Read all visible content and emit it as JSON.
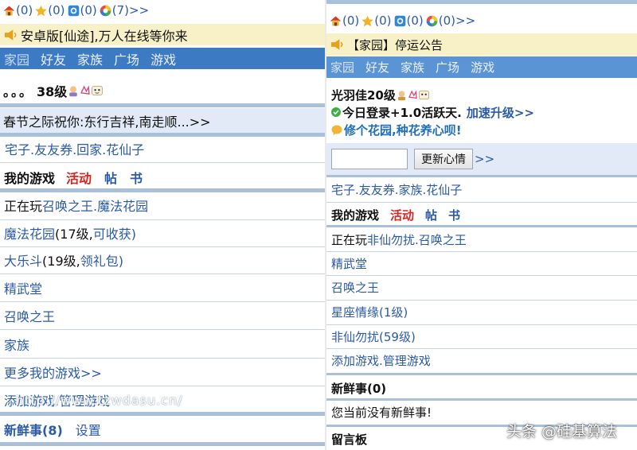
{
  "left": {
    "status_counts": [
      "(0)",
      "(0)",
      "(0)",
      "(7)>>"
    ],
    "status_icons": [
      "home-icon",
      "star-icon",
      "message-icon",
      "ring-icon"
    ],
    "notice": "安卓版[仙途],万人在线等你来",
    "nav": [
      "家园",
      "好友",
      "家族",
      "广场",
      "游戏"
    ],
    "user_dots": "。。。",
    "user_level": "38级",
    "greeting": "春节之际祝你:东行吉祥,南走顺...>>",
    "links_line": "宅子.友友券.回家.花仙子",
    "games_header": {
      "title": "我的游戏",
      "activity": "活动",
      "post": "帖",
      "book": "书"
    },
    "playing_prefix": "正在玩",
    "playing_games": "召唤之王.魔法花园",
    "games": [
      {
        "name": "魔法花园",
        "note": "(17级,",
        "action": "可收获)"
      },
      {
        "name": "大乐斗",
        "note": "(19级,",
        "action": "领礼包)"
      }
    ],
    "simple_items": [
      "精武堂",
      "召唤之王",
      "家族",
      "更多我的游戏>>",
      "添加游戏.管理游戏"
    ],
    "news": "新鲜事(8)",
    "settings": "设置"
  },
  "right": {
    "status_counts": [
      "(0)",
      "(0)",
      "(0)",
      "(0)>>"
    ],
    "status_icons": [
      "home-icon",
      "star-icon",
      "message-icon",
      "ring-icon"
    ],
    "notice": "【家园】停运公告",
    "nav": [
      "家园",
      "好友",
      "家族",
      "广场",
      "游戏"
    ],
    "user_name": "光羽佳20级",
    "login_text": "今日登录+1.0活跃天.",
    "upgrade_link": "加速升级>>",
    "garden_text": "修个花园,种花养心呗!",
    "mood_button": "更新心情",
    "mood_arrow": ">>",
    "links_line": "宅子.友友券.家族.花仙子",
    "games_header": {
      "title": "我的游戏",
      "activity": "活动",
      "post": "帖",
      "book": "书"
    },
    "playing_prefix": "正在玩",
    "playing_games": "非仙勿扰.召唤之王",
    "items": [
      "精武堂",
      "召唤之王",
      "星座情缘(1级)",
      "非仙勿扰(59级)",
      "添加游戏.管理游戏"
    ],
    "news": "新鲜事(0)",
    "news_empty": "您当前没有新鲜事!",
    "guestbook": "留言板"
  },
  "watermark_center": "http://www.tzwdasu.cn/",
  "watermark_corner": "头条 @硅基算法"
}
